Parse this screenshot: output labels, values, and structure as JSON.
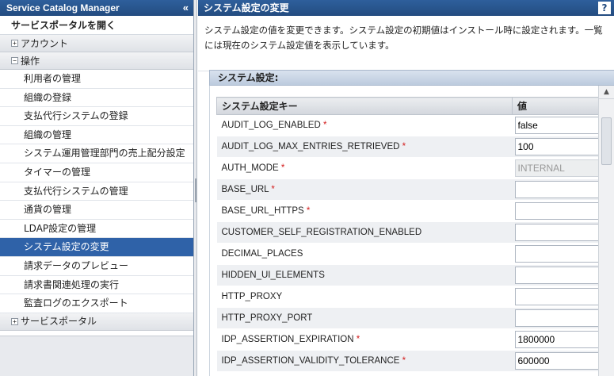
{
  "sidebar": {
    "title": "Service Catalog Manager",
    "collapse_icon": "«",
    "portal_open": "サービスポータルを開く",
    "groups": {
      "account": "アカウント",
      "operations": "操作",
      "service_portal": "サービスポータル"
    },
    "items": [
      {
        "label": "利用者の管理",
        "selected": false
      },
      {
        "label": "組織の登録",
        "selected": false
      },
      {
        "label": "支払代行システムの登録",
        "selected": false
      },
      {
        "label": "組織の管理",
        "selected": false
      },
      {
        "label": "システム運用管理部門の売上配分設定",
        "selected": false
      },
      {
        "label": "タイマーの管理",
        "selected": false
      },
      {
        "label": "支払代行システムの管理",
        "selected": false
      },
      {
        "label": "通貨の管理",
        "selected": false
      },
      {
        "label": "LDAP設定の管理",
        "selected": false
      },
      {
        "label": "システム設定の変更",
        "selected": true
      },
      {
        "label": "請求データのプレビュー",
        "selected": false
      },
      {
        "label": "請求書関連処理の実行",
        "selected": false
      },
      {
        "label": "監査ログのエクスポート",
        "selected": false
      }
    ]
  },
  "main": {
    "title": "システム設定の変更",
    "help_label": "?",
    "description": "システム設定の値を変更できます。システム設定の初期値はインストール時に設定されます。一覧には現在のシステム設定値を表示しています。",
    "panel_title": "システム設定:",
    "columns": {
      "key": "システム設定キー",
      "value": "値"
    },
    "rows": [
      {
        "key": "AUDIT_LOG_ENABLED",
        "required": true,
        "value": "false",
        "disabled": false
      },
      {
        "key": "AUDIT_LOG_MAX_ENTRIES_RETRIEVED",
        "required": true,
        "value": "100",
        "disabled": false
      },
      {
        "key": "AUTH_MODE",
        "required": true,
        "value": "INTERNAL",
        "disabled": true
      },
      {
        "key": "BASE_URL",
        "required": true,
        "value": "",
        "disabled": false
      },
      {
        "key": "BASE_URL_HTTPS",
        "required": true,
        "value": "",
        "disabled": false
      },
      {
        "key": "CUSTOMER_SELF_REGISTRATION_ENABLED",
        "required": false,
        "value": "",
        "disabled": false
      },
      {
        "key": "DECIMAL_PLACES",
        "required": false,
        "value": "",
        "disabled": false
      },
      {
        "key": "HIDDEN_UI_ELEMENTS",
        "required": false,
        "value": "",
        "disabled": false
      },
      {
        "key": "HTTP_PROXY",
        "required": false,
        "value": "",
        "disabled": false
      },
      {
        "key": "HTTP_PROXY_PORT",
        "required": false,
        "value": "",
        "disabled": false
      },
      {
        "key": "IDP_ASSERTION_EXPIRATION",
        "required": true,
        "value": "1800000",
        "disabled": false
      },
      {
        "key": "IDP_ASSERTION_VALIDITY_TOLERANCE",
        "required": true,
        "value": "600000",
        "disabled": false
      }
    ],
    "required_mark": "*"
  },
  "colors": {
    "header_blue": "#234c80",
    "selected_blue": "#2f62a8",
    "required_red": "#d31c1c"
  }
}
